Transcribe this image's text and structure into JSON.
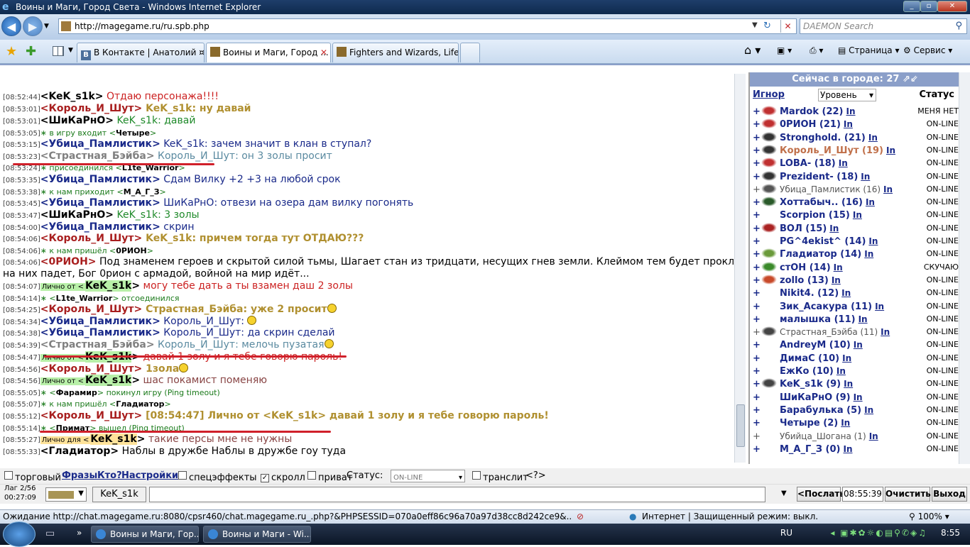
{
  "window": {
    "title": "Воины и Маги, Город Света - Windows Internet Explorer"
  },
  "address": {
    "url": "http://magegame.ru/ru.spb.php"
  },
  "search": {
    "placeholder": "DAEMON Search"
  },
  "tabs": [
    {
      "label": "В Контакте | Анатолий ¤F..."
    },
    {
      "label": "Воины и Маги, Город ..."
    },
    {
      "label": "Fighters and Wizards, Life ..."
    }
  ],
  "toolbar": {
    "page": "Страница",
    "service": "Сервис"
  },
  "chat": [
    {
      "t": "[08:52:44]",
      "pre": "<",
      "u": "KeK_s1k",
      "post": ">",
      "nc": "n1",
      "mc": "m1",
      "m": " Отдаю персонажа!!!!",
      "kind": "msg"
    },
    {
      "t": "[08:53:01]",
      "pre": "<",
      "u": "Король_И_Шут",
      "post": ">",
      "nc": "n2",
      "mc": "m2",
      "m": " KeK_s1k: ну давай",
      "kind": "msg"
    },
    {
      "t": "[08:53:01]",
      "pre": "<",
      "u": "ШиКаРнО",
      "post": ">",
      "nc": "n1",
      "mc": "m3",
      "m": " KeK_s1k: давай",
      "kind": "msg"
    },
    {
      "t": "[08:53:05]",
      "sys": "∗ в игру входит <",
      "su": "Четыре",
      "se": ">",
      "kind": "sys"
    },
    {
      "t": "[08:53:15]",
      "pre": "<",
      "u": "Убица_Памлистик",
      "post": ">",
      "nc": "n3",
      "mc": "m4",
      "m": " KeK_s1k: зачем значит в клан в ступал?",
      "kind": "msg"
    },
    {
      "t": "[08:53:23]",
      "pre": "<",
      "u": "Страстная_Бэйба",
      "post": ">",
      "nc": "n4",
      "mc": "m5",
      "m": " Король_И_Шут: он 3 золы просит",
      "kind": "msg"
    },
    {
      "t": "[08:53:24]",
      "sys": "∗ присоединился <",
      "su": "L1te_Warrior",
      "se": ">",
      "kind": "sys"
    },
    {
      "t": "[08:53:35]",
      "pre": "<",
      "u": "Убица_Памлистик",
      "post": ">",
      "nc": "n3",
      "mc": "m4",
      "m": " Сдам Вилку +2 +3 на любой срок",
      "kind": "msg"
    },
    {
      "t": "[08:53:38]",
      "sys": "∗ к нам приходит <",
      "su": "М_А_Г_З",
      "se": ">",
      "kind": "sys"
    },
    {
      "t": "[08:53:45]",
      "pre": "<",
      "u": "Убица_Памлистик",
      "post": ">",
      "nc": "n3",
      "mc": "m4",
      "m": " ШиКаРнО: отвези на озера дам вилку погонять",
      "kind": "msg"
    },
    {
      "t": "[08:53:47]",
      "pre": "<",
      "u": "ШиКаРнО",
      "post": ">",
      "nc": "n1",
      "mc": "m3",
      "m": " KeK_s1k: 3 золы",
      "kind": "msg"
    },
    {
      "t": "[08:54:00]",
      "pre": "<",
      "u": "Убица_Памлистик",
      "post": ">",
      "nc": "n3",
      "mc": "m4",
      "m": " скрин",
      "kind": "msg"
    },
    {
      "t": "[08:54:06]",
      "pre": "<",
      "u": "Король_И_Шут",
      "post": ">",
      "nc": "n2",
      "mc": "m2",
      "m": " KeK_s1k: причем тогда тут ОТДАЮ???",
      "kind": "msg"
    },
    {
      "t": "[08:54:06]",
      "sys": "∗ к нам пришёл <",
      "su": "0РИОН",
      "se": ">",
      "kind": "sys"
    },
    {
      "t": "[08:54:06]",
      "pre": "<",
      "u": "0РИОН",
      "post": ">",
      "nc": "n2",
      "mc": "m6",
      "m": " Под знаменем героев и скрытой силой тьмы, Шагает стан из тридцати, несущих гнев земли. Клеймом тем будет проклят, чей взгляд",
      "kind": "msg"
    },
    {
      "t": "",
      "pre": "",
      "u": "",
      "post": "",
      "nc": "n1",
      "mc": "m6",
      "m": "на них падет, Бог 0рион с армадой, войной на мир идёт...",
      "kind": "cont"
    },
    {
      "t": "[08:54:07]",
      "pr": "Лично от <",
      "u": "KeK_s1k",
      "post": ">",
      "nc": "n1",
      "mc": "m1",
      "m": " могу тебе дать а ты взамен даш 2 золы",
      "kind": "priv"
    },
    {
      "t": "[08:54:14]",
      "sys": "∗ <",
      "su": "L1te_Warrior",
      "se": "> отсоединился",
      "kind": "sys"
    },
    {
      "t": "[08:54:25]",
      "pre": "<",
      "u": "Король_И_Шут",
      "post": ">",
      "nc": "n2",
      "mc": "m2",
      "m": " Страстная_Бэйба: уже 2 просит",
      "kind": "msg",
      "smile": true
    },
    {
      "t": "[08:54:34]",
      "pre": "<",
      "u": "Убица_Памлистик",
      "post": ">",
      "nc": "n3",
      "mc": "m4",
      "m": " Король_И_Шут: ",
      "kind": "msg",
      "smile": true
    },
    {
      "t": "[08:54:38]",
      "pre": "<",
      "u": "Убица_Памлистик",
      "post": ">",
      "nc": "n3",
      "mc": "m4",
      "m": " Король_И_Шут: да скрин сделай",
      "kind": "msg"
    },
    {
      "t": "[08:54:39]",
      "pre": "<",
      "u": "Страстная_Бэйба",
      "post": ">",
      "nc": "n4",
      "mc": "m5",
      "m": " Король_И_Шут: мелочь пузатая",
      "kind": "msg",
      "smile": true
    },
    {
      "t": "[08:54:47]",
      "pr": "Лично от <",
      "u": "KeK_s1k",
      "post": ">",
      "nc": "n1",
      "mc": "m1",
      "m": " давай 1 золу и я тебе говорю пароль!",
      "kind": "priv"
    },
    {
      "t": "[08:54:56]",
      "pre": "<",
      "u": "Король_И_Шут",
      "post": ">",
      "nc": "n2",
      "mc": "m2",
      "m": " 1зола",
      "kind": "msg",
      "smile": true
    },
    {
      "t": "[08:54:56]",
      "pr": "Лично от <",
      "u": "KeK_s1k",
      "post": ">",
      "nc": "n1",
      "mc": "m7",
      "m": " шас покамист поменяю",
      "kind": "priv"
    },
    {
      "t": "[08:55:05]",
      "sys": "∗ <",
      "su": "Фарамир",
      "se": "> покинул игру (Ping timeout)",
      "kind": "sys"
    },
    {
      "t": "[08:55:07]",
      "sys": "∗ к нам пришёл <",
      "su": "Гладиатор",
      "se": ">",
      "kind": "sys"
    },
    {
      "t": "[08:55:12]",
      "pre": "<",
      "u": "Король_И_Шут",
      "post": ">",
      "nc": "n2",
      "mc": "m2",
      "m": " [08:54:47] Лично от <KeK_s1k> давай 1 золу и я тебе говорю пароль!",
      "kind": "msg"
    },
    {
      "t": "[08:55:14]",
      "sys": "∗ <",
      "su": "Примат",
      "se": "> вышел (Ping timeout)",
      "kind": "sys"
    },
    {
      "t": "[08:55:27]",
      "pr2": "Лично для <",
      "u": "KeK_s1k",
      "post": ">",
      "nc": "n1",
      "mc": "m7",
      "m": " такие персы мне не нужны",
      "kind": "priv2"
    },
    {
      "t": "[08:55:33]",
      "pre": "<",
      "u": "Гладиатор",
      "post": ">",
      "nc": "n1",
      "mc": "m6",
      "m": " Наблы в дружбе Наблы в дружбе гоу туда",
      "kind": "msg"
    }
  ],
  "userlist": {
    "header": "Сейчас в городе: 27",
    "col_ignore": "Игнор",
    "col_level": "Уровень",
    "col_status": "Статус",
    "users": [
      {
        "name": "Mardok (22)",
        "status": "МЕНЯ НЕТ",
        "color": "#1a2a8a"
      },
      {
        "name": "0РИОН (21)",
        "status": "ON-LINE",
        "color": "#1a2a8a"
      },
      {
        "name": "Stronghold. (21)",
        "status": "ON-LINE",
        "color": "#1a2a8a"
      },
      {
        "name": "Король_И_Шут (19)",
        "status": "ON-LINE",
        "color": "#c0704a"
      },
      {
        "name": "LOBA- (18)",
        "status": "ON-LINE",
        "color": "#1a2a8a"
      },
      {
        "name": "Prezident- (18)",
        "status": "ON-LINE",
        "color": "#1a2a8a"
      },
      {
        "name": "Убица_Памлистик (16)",
        "status": "ON-LINE",
        "color": "#555",
        "light": true
      },
      {
        "name": "Хоттабыч.. (16)",
        "status": "ON-LINE",
        "color": "#1a2a8a"
      },
      {
        "name": "Scorpion (15)",
        "status": "ON-LINE",
        "color": "#1a2a8a"
      },
      {
        "name": "ВОЛ (15)",
        "status": "ON-LINE",
        "color": "#1a2a8a"
      },
      {
        "name": "PG^4ekist^ (14)",
        "status": "ON-LINE",
        "color": "#1a2a8a"
      },
      {
        "name": "Гладиатор (14)",
        "status": "ON-LINE",
        "color": "#1a2a8a"
      },
      {
        "name": "стОН (14)",
        "status": "СКУЧАЮ",
        "color": "#1a2a8a"
      },
      {
        "name": "zollo (13)",
        "status": "ON-LINE",
        "color": "#1a2a8a"
      },
      {
        "name": "Nikit4. (12)",
        "status": "ON-LINE",
        "color": "#1a2a8a"
      },
      {
        "name": "Зик_Асакура (11)",
        "status": "ON-LINE",
        "color": "#1a2a8a"
      },
      {
        "name": "малышка (11)",
        "status": "ON-LINE",
        "color": "#1a2a8a"
      },
      {
        "name": "Страстная_Бэйба (11)",
        "status": "ON-LINE",
        "color": "#555",
        "light": true
      },
      {
        "name": "AndreyM (10)",
        "status": "ON-LINE",
        "color": "#1a2a8a"
      },
      {
        "name": "ДимаС (10)",
        "status": "ON-LINE",
        "color": "#1a2a8a"
      },
      {
        "name": "ЕжКо (10)",
        "status": "ON-LINE",
        "color": "#1a2a8a"
      },
      {
        "name": "KeK_s1k (9)",
        "status": "ON-LINE",
        "color": "#1a2a8a"
      },
      {
        "name": "ШиКаРнО (9)",
        "status": "ON-LINE",
        "color": "#1a2a8a"
      },
      {
        "name": "Барабулька (5)",
        "status": "ON-LINE",
        "color": "#1a2a8a"
      },
      {
        "name": "Четыре (2)",
        "status": "ON-LINE",
        "color": "#1a2a8a"
      },
      {
        "name": "Убийца_Шогана (1)",
        "status": "ON-LINE",
        "color": "#555",
        "light": true
      },
      {
        "name": "М_А_Г_З (0)",
        "status": "ON-LINE",
        "color": "#1a2a8a"
      }
    ],
    "in_label": "In",
    "plus": "+"
  },
  "controls": {
    "trade": "торговый",
    "phrases": "Фразы",
    "who": "Кто?",
    "settings": "Настройки",
    "effects": "спецэффекты",
    "scroll": "скролл",
    "private": "приват",
    "status_label": "Статус:",
    "status_value": "ON-LINE",
    "translit": "транслит",
    "help": "<?>",
    "lag": "Лаг 2/56",
    "lag_time": "00:27:09",
    "nick": "KeK_s1k",
    "send": "<Послать",
    "time": "08:55:39",
    "clear": "Очистить",
    "exit": "Выход"
  },
  "statusbar": {
    "left": "Ожидание http://chat.magegame.ru:8080/cpsr460/chat.magegame.ru_.php?&PHPSESSID=070a0eff86c96a70a97d38cc8d242ce9&...",
    "zone": "Интернет | Защищенный режим: выкл.",
    "zoom": "100%"
  },
  "taskbar": {
    "t1": "Воины и Маги, Гор...",
    "t2": "Воины и Маги - Wi...",
    "lang": "RU",
    "clock": "8:55"
  }
}
